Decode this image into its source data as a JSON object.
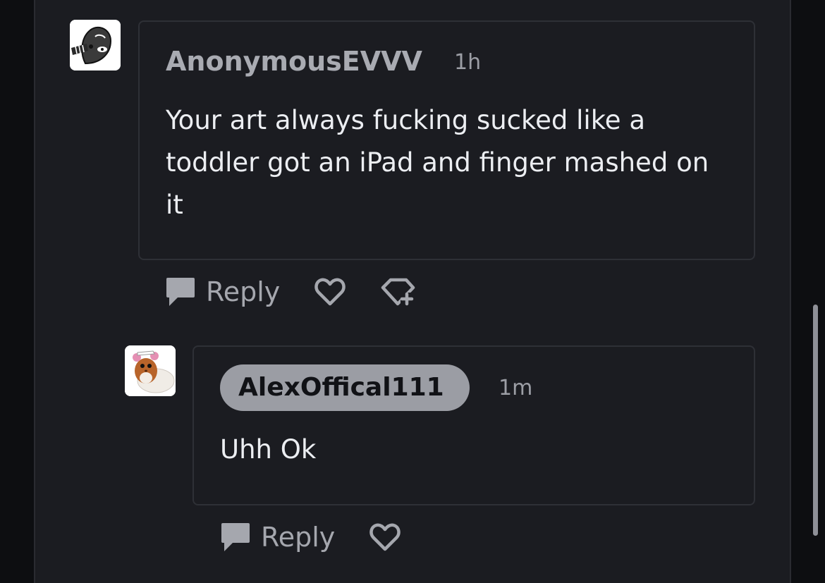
{
  "comments": [
    {
      "username": "AnonymousEVVV",
      "time": "1h",
      "text": "Your art always fucking sucked like a toddler got an iPad and finger mashed on it",
      "actions": {
        "reply_label": "Reply",
        "like_icon": "heart-outline-icon",
        "award_icon": "award-icon"
      }
    },
    {
      "username": "AlexOffical111",
      "time": "1m",
      "text": "Uhh Ok",
      "actions": {
        "reply_label": "Reply",
        "like_icon": "heart-outline-icon"
      }
    }
  ],
  "colors": {
    "background": "#0d0e11",
    "panel": "#1b1c21",
    "card_border": "#2e3036",
    "text": "#eceef2",
    "muted": "#a5a7ae",
    "op_pill": "#9b9da4"
  }
}
